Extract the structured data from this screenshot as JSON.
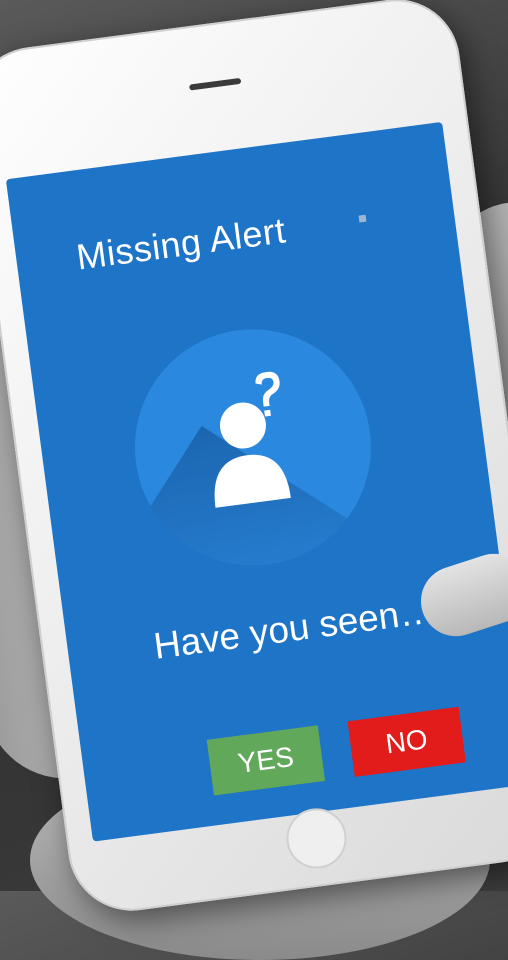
{
  "screen": {
    "title": "Missing Alert",
    "prompt": "Have you seen…",
    "background_color": "#1e74c7",
    "avatar_icon": "missing-person-question-icon"
  },
  "actions": {
    "yes_label": "YES",
    "no_label": "NO",
    "yes_color": "#62a85a",
    "no_color": "#e21b1b"
  }
}
